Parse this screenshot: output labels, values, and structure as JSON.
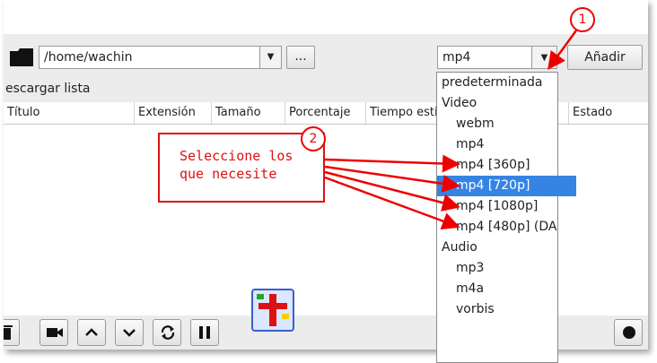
{
  "toolbar": {
    "path_value": "/home/wachin",
    "browse_label": "...",
    "format_value": "mp4",
    "add_label": "Añadir"
  },
  "list_label": "escargar lista",
  "columns": [
    "Título",
    "Extensión",
    "Tamaño",
    "Porcentaje",
    "Tiempo esti",
    "Estado"
  ],
  "dropdown": {
    "options": [
      {
        "label": "predeterminada",
        "kind": "cat"
      },
      {
        "label": "Video",
        "kind": "cat"
      },
      {
        "label": "webm",
        "kind": "sub"
      },
      {
        "label": "mp4",
        "kind": "sub"
      },
      {
        "label": "mp4 [360p]",
        "kind": "sub"
      },
      {
        "label": "mp4 [720p]",
        "kind": "sub",
        "selected": true
      },
      {
        "label": "mp4 [1080p]",
        "kind": "sub"
      },
      {
        "label": "mp4 [480p] (DA",
        "kind": "sub"
      },
      {
        "label": "Audio",
        "kind": "cat"
      },
      {
        "label": "mp3",
        "kind": "sub"
      },
      {
        "label": "m4a",
        "kind": "sub"
      },
      {
        "label": "vorbis",
        "kind": "sub"
      }
    ]
  },
  "annotation": {
    "line1": "Seleccione los",
    "line2": "que necesite",
    "badge1": "1",
    "badge2": "2",
    "color": "#dd1111"
  },
  "icons": [
    "folder-icon",
    "chevron-down-icon",
    "trash-icon",
    "video-camera-icon",
    "arrow-up-icon",
    "arrow-down-icon",
    "refresh-icon",
    "pause-icon",
    "logo-icon",
    "settings-icon"
  ]
}
